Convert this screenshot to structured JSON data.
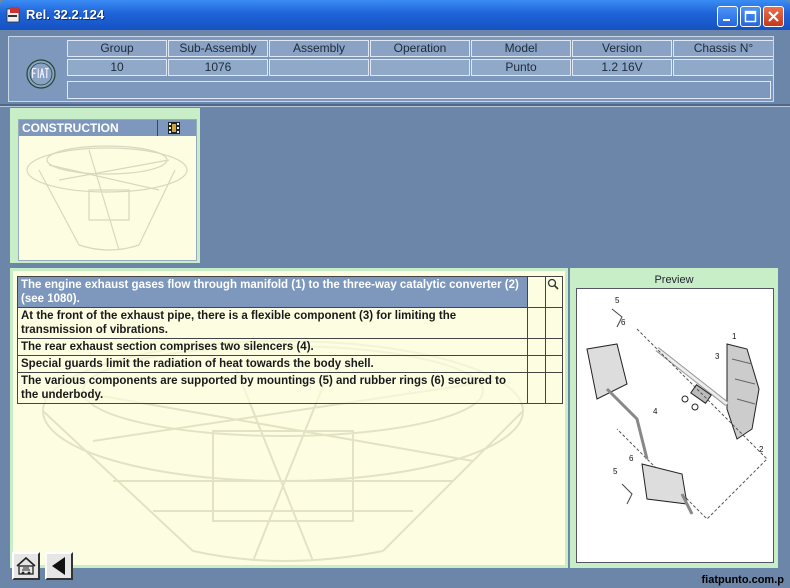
{
  "window": {
    "title": "Rel. 32.2.124"
  },
  "header": {
    "columns": [
      {
        "label": "Group",
        "value": "10"
      },
      {
        "label": "Sub-Assembly",
        "value": "1076"
      },
      {
        "label": "Assembly",
        "value": ""
      },
      {
        "label": "Operation",
        "value": ""
      },
      {
        "label": "Model",
        "value": "Punto"
      },
      {
        "label": "Version",
        "value": "1.2 16V"
      },
      {
        "label": "Chassis N°",
        "value": ""
      }
    ]
  },
  "construction": {
    "title": "CONSTRUCTION"
  },
  "steps": [
    {
      "text": "The engine exhaust gases flow through manifold  (1)  to the three-way catalytic converter (2) (see 1080)."
    },
    {
      "text": "At the front of the exhaust pipe, there is a flexible component (3) for limiting the transmission of vibrations."
    },
    {
      "text": "The rear exhaust section comprises two silencers (4)."
    },
    {
      "text": "Special guards limit the radiation of heat towards the body shell."
    },
    {
      "text": "The various components are supported by mountings (5) and rubber rings (6) secured to the underbody."
    }
  ],
  "preview": {
    "label": "Preview",
    "callouts": [
      "1",
      "2",
      "3",
      "4",
      "5",
      "6",
      "5",
      "6"
    ]
  },
  "footer": {
    "site": "fiatpunto.com.p"
  },
  "colors": {
    "titlebar": "#1f63d8",
    "panel_bg": "#6b86a8",
    "highlight_row": "#7d98bc",
    "panel_green": "#c8eec8",
    "paper": "#fdfde2"
  }
}
